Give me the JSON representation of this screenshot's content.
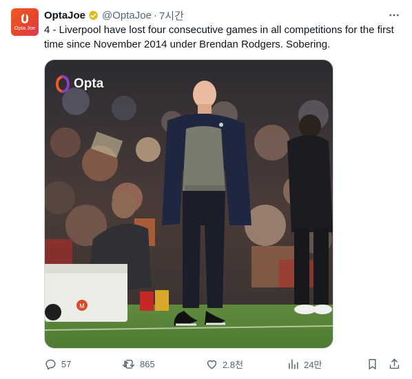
{
  "tweet": {
    "avatar_text": "Opta Joe",
    "display_name": "OptaJoe",
    "handle": "@OptaJoe",
    "separator": "·",
    "time": "7시간",
    "text": "4 - Liverpool have lost four consecutive games in all competitions for the first time since November 2014 under Brendan Rodgers. Sobering.",
    "media": {
      "watermark": "Opta",
      "crest_text": "M"
    }
  },
  "actions": {
    "reply_count": "57",
    "retweet_count": "865",
    "like_count": "2.8천",
    "views_count": "24만"
  },
  "colors": {
    "text": "#0f1419",
    "secondary": "#536471",
    "verified": "#e2b719",
    "border": "#cfd9de",
    "opta_orange": "#f15a24"
  },
  "icons": [
    "verified-badge-icon",
    "more-icon",
    "reply-icon",
    "retweet-icon",
    "like-icon",
    "views-icon",
    "bookmark-icon",
    "share-icon"
  ]
}
